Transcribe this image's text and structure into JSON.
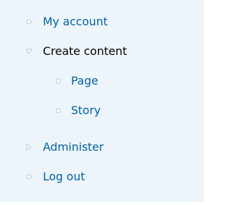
{
  "menu": {
    "items": [
      {
        "label": "My account",
        "icon": "circle-bullet-icon",
        "expanded": false
      },
      {
        "label": "Create content",
        "icon": "triangle-down-icon",
        "expanded": true,
        "children": [
          {
            "label": "Page",
            "icon": "circle-bullet-icon"
          },
          {
            "label": "Story",
            "icon": "circle-bullet-icon"
          }
        ]
      },
      {
        "label": "Administer",
        "icon": "triangle-right-icon",
        "expanded": false
      },
      {
        "label": "Log out",
        "icon": "circle-bullet-icon",
        "expanded": false
      }
    ]
  },
  "colors": {
    "background": "#edf5fa",
    "link": "#0062a0",
    "text": "#000000",
    "bullet": "#b6c6d1"
  }
}
